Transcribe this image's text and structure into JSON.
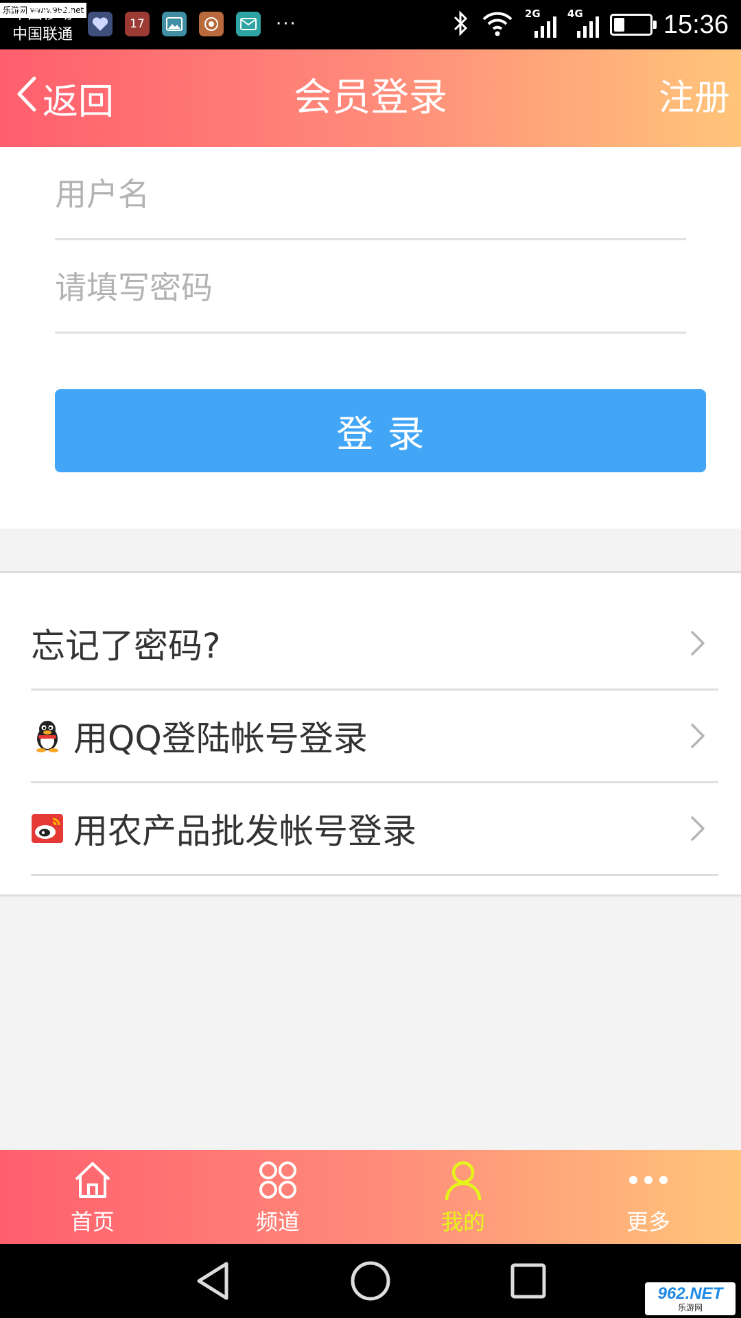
{
  "status_bar": {
    "watermark": "乐游网 www.962.net",
    "carrier_1": "中国移动",
    "carrier_2": "中国联通",
    "more": "···",
    "signal_1_gen": "2G",
    "signal_2_gen": "4G",
    "battery_level": 0.3,
    "time": "15:36",
    "app_icons": [
      "health-icon",
      "calendar-icon",
      "gallery-icon",
      "camera-icon",
      "mail-icon"
    ],
    "calendar_day": "17"
  },
  "header": {
    "back_label": "返回",
    "title": "会员登录",
    "register_label": "注册"
  },
  "form": {
    "username_placeholder": "用户名",
    "username_value": "",
    "password_placeholder": "请填写密码",
    "password_value": "",
    "login_label": "登录"
  },
  "options": [
    {
      "label": "忘记了密码?",
      "icon": ""
    },
    {
      "label": "用QQ登陆帐号登录",
      "icon": "qq-penguin-icon"
    },
    {
      "label": "用农产品批发帐号登录",
      "icon": "weibo-icon"
    }
  ],
  "tabbar": {
    "tabs": [
      {
        "label": "首页",
        "icon": "home-icon",
        "active": false
      },
      {
        "label": "频道",
        "icon": "grid-icon",
        "active": false
      },
      {
        "label": "我的",
        "icon": "person-icon",
        "active": true
      },
      {
        "label": "更多",
        "icon": "more-dots-icon",
        "active": false
      }
    ]
  },
  "colors": {
    "header_gradient_start": "#ff5f6d",
    "header_gradient_end": "#ffc57a",
    "login_button": "#42a5f5",
    "active_tab": "#e5f51a"
  },
  "corner_logo": {
    "big": "962.NET",
    "small": "乐游网"
  }
}
